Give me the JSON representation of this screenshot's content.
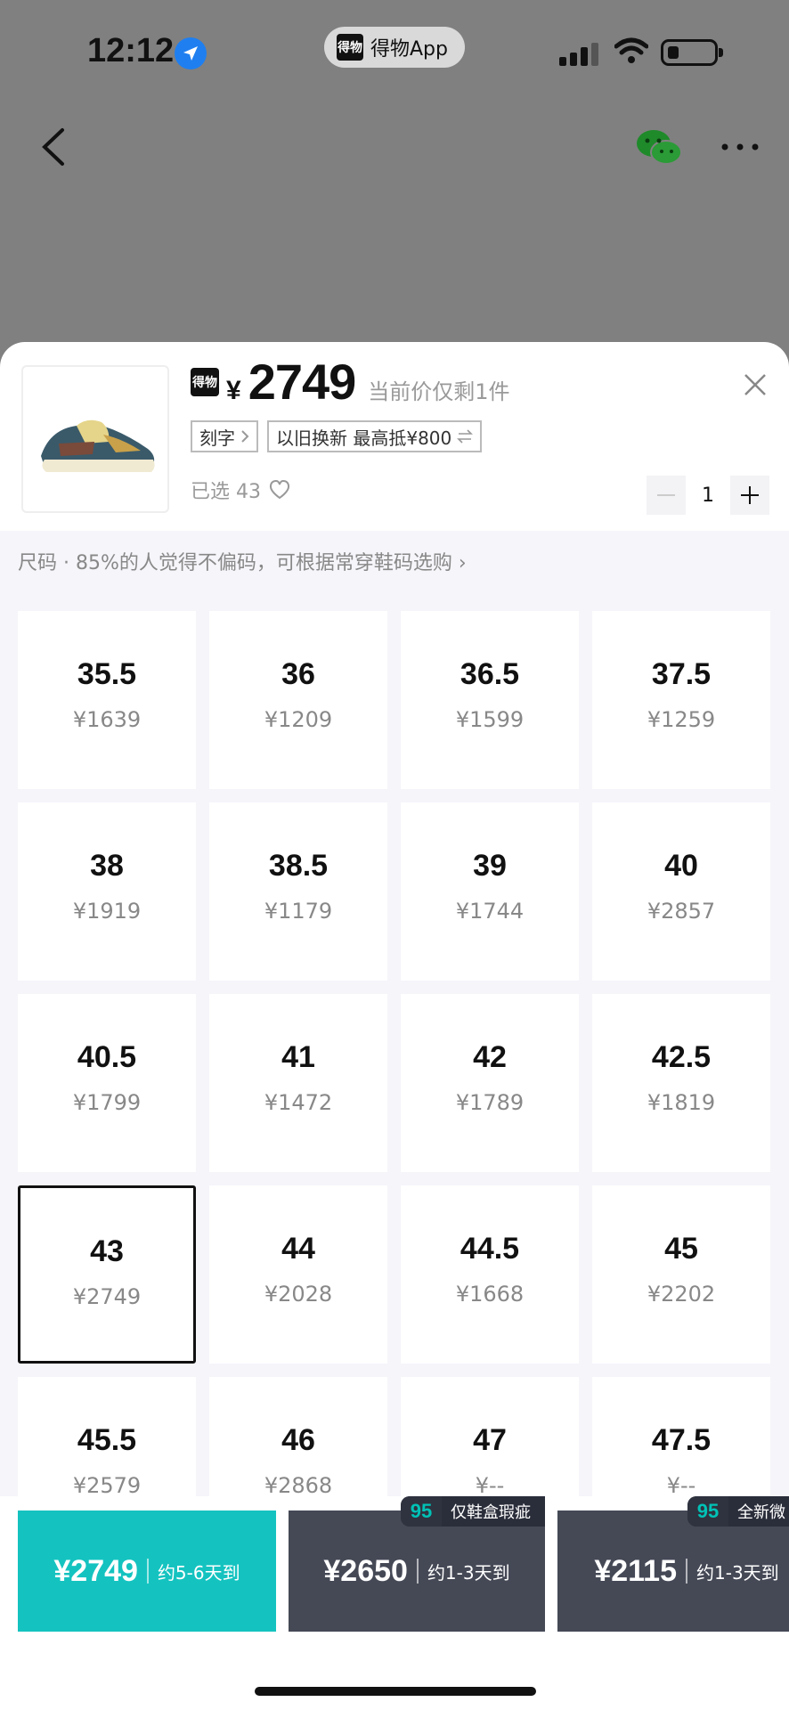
{
  "status_bar": {
    "time": "12:12",
    "app_name": "得物App",
    "app_logo": "得物"
  },
  "nav": {
    "back_icon": "chevron-left-icon",
    "share_icon": "wechat-icon",
    "more_icon": "more-icon"
  },
  "product": {
    "brand_mark": "得物",
    "currency": "¥",
    "price": "2749",
    "price_note": "当前价仅剩1件",
    "tags": [
      {
        "label": "刻字"
      },
      {
        "label": "以旧换新 最高抵¥800"
      }
    ],
    "selected_label": "已选 43",
    "quantity": "1"
  },
  "size_hint": "尺码 · 85%的人觉得不偏码，可根据常穿鞋码选购",
  "sizes": [
    {
      "size": "35.5",
      "price": "¥1639"
    },
    {
      "size": "36",
      "price": "¥1209"
    },
    {
      "size": "36.5",
      "price": "¥1599"
    },
    {
      "size": "37.5",
      "price": "¥1259"
    },
    {
      "size": "38",
      "price": "¥1919"
    },
    {
      "size": "38.5",
      "price": "¥1179"
    },
    {
      "size": "39",
      "price": "¥1744"
    },
    {
      "size": "40",
      "price": "¥2857"
    },
    {
      "size": "40.5",
      "price": "¥1799"
    },
    {
      "size": "41",
      "price": "¥1472"
    },
    {
      "size": "42",
      "price": "¥1789"
    },
    {
      "size": "42.5",
      "price": "¥1819"
    },
    {
      "size": "43",
      "price": "¥2749"
    },
    {
      "size": "44",
      "price": "¥2028"
    },
    {
      "size": "44.5",
      "price": "¥1668"
    },
    {
      "size": "45",
      "price": "¥2202"
    },
    {
      "size": "45.5",
      "price": "¥2579"
    },
    {
      "size": "46",
      "price": "¥2868"
    },
    {
      "size": "47",
      "price": "¥--"
    },
    {
      "size": "47.5",
      "price": "¥--"
    }
  ],
  "selected_size": "43",
  "buy_options": [
    {
      "price": "¥2749",
      "delivery": "约5-6天到",
      "color": "#14c3c0"
    },
    {
      "price": "¥2650",
      "delivery": "约1-3天到",
      "badge_num": "95",
      "badge_text": "仅鞋盒瑕疵",
      "color": "#454956"
    },
    {
      "price": "¥2115",
      "delivery": "约1-3天到",
      "badge_num": "95",
      "badge_text": "全新微",
      "color": "#454956"
    }
  ]
}
